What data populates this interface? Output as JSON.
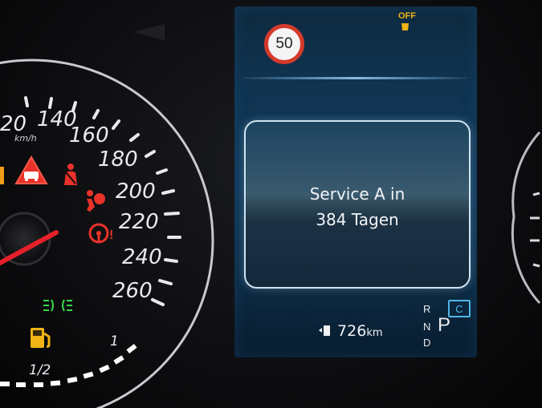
{
  "speedometer": {
    "unit": "km/h",
    "labels": [
      "20",
      "140",
      "160",
      "180",
      "200",
      "220",
      "240",
      "260"
    ]
  },
  "fuel": {
    "half_label": "1/2",
    "full_label": "1"
  },
  "display": {
    "speed_limit": "50",
    "off_indicator": "OFF",
    "message_line1": "Service A in",
    "message_line2": "384 Tagen",
    "range_value": "726",
    "range_unit": "km",
    "gears": {
      "r": "R",
      "n": "N",
      "d": "D",
      "current": "P"
    },
    "mode": "C"
  },
  "colors": {
    "warning_red": "#e8322a",
    "indicator_green": "#3ad84a",
    "amber": "#f0b414",
    "screen_accent": "#4fb6e6",
    "needle": "#e8202a"
  }
}
